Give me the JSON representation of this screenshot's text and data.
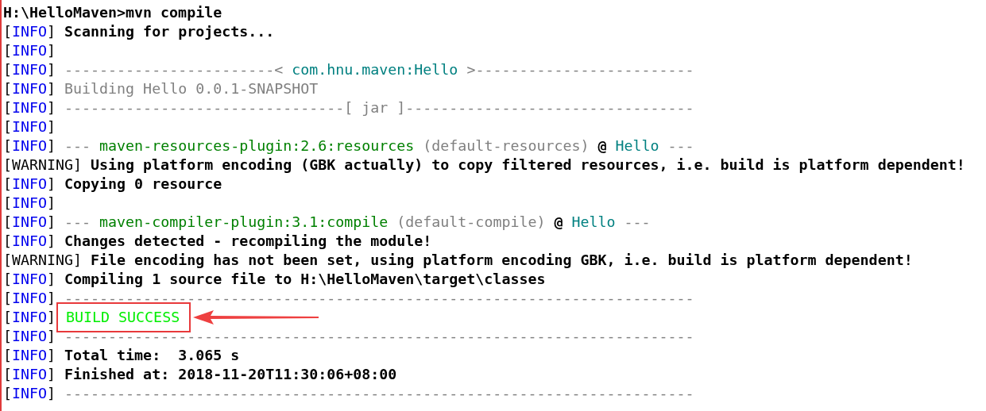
{
  "console": {
    "lines": [
      {
        "segments": [
          {
            "kind": "prompt",
            "text": "H:\\HelloMaven>mvn compile"
          }
        ]
      },
      {
        "segments": [
          {
            "kind": "bracket",
            "text": "["
          },
          {
            "kind": "tag",
            "text": "INFO"
          },
          {
            "kind": "bracket",
            "text": "]"
          },
          {
            "kind": "text",
            "text": " Scanning for projects..."
          }
        ]
      },
      {
        "segments": [
          {
            "kind": "bracket",
            "text": "["
          },
          {
            "kind": "tag",
            "text": "INFO"
          },
          {
            "kind": "bracket",
            "text": "]"
          }
        ]
      },
      {
        "segments": [
          {
            "kind": "bracket",
            "text": "["
          },
          {
            "kind": "tag",
            "text": "INFO"
          },
          {
            "kind": "bracket",
            "text": "]"
          },
          {
            "kind": "dim",
            "text": " ------------------------<"
          },
          {
            "kind": "module",
            "text": " com.hnu.maven:Hello "
          },
          {
            "kind": "dim",
            "text": ">-------------------------"
          }
        ]
      },
      {
        "segments": [
          {
            "kind": "bracket",
            "text": "["
          },
          {
            "kind": "tag",
            "text": "INFO"
          },
          {
            "kind": "bracket",
            "text": "]"
          },
          {
            "kind": "dim",
            "text": " Building Hello 0.0.1-SNAPSHOT"
          }
        ]
      },
      {
        "segments": [
          {
            "kind": "bracket",
            "text": "["
          },
          {
            "kind": "tag",
            "text": "INFO"
          },
          {
            "kind": "bracket",
            "text": "]"
          },
          {
            "kind": "dim",
            "text": " --------------------------------[ jar ]---------------------------------"
          }
        ]
      },
      {
        "segments": [
          {
            "kind": "bracket",
            "text": "["
          },
          {
            "kind": "tag",
            "text": "INFO"
          },
          {
            "kind": "bracket",
            "text": "]"
          }
        ]
      },
      {
        "segments": [
          {
            "kind": "bracket",
            "text": "["
          },
          {
            "kind": "tag",
            "text": "INFO"
          },
          {
            "kind": "bracket",
            "text": "]"
          },
          {
            "kind": "dim",
            "text": " ---"
          },
          {
            "kind": "plugin",
            "text": " maven-resources-plugin:2.6:resources"
          },
          {
            "kind": "dim",
            "text": " (default-resources)"
          },
          {
            "kind": "text",
            "text": " @"
          },
          {
            "kind": "module",
            "text": " Hello"
          },
          {
            "kind": "dim",
            "text": " ---"
          }
        ]
      },
      {
        "segments": [
          {
            "kind": "bracket",
            "text": "[WARNING]"
          },
          {
            "kind": "text",
            "text": " Using platform encoding (GBK actually) to copy filtered resources, i.e. build is platform dependent!"
          }
        ]
      },
      {
        "segments": [
          {
            "kind": "bracket",
            "text": "["
          },
          {
            "kind": "tag",
            "text": "INFO"
          },
          {
            "kind": "bracket",
            "text": "]"
          },
          {
            "kind": "text",
            "text": " Copying 0 resource"
          }
        ]
      },
      {
        "segments": [
          {
            "kind": "bracket",
            "text": "["
          },
          {
            "kind": "tag",
            "text": "INFO"
          },
          {
            "kind": "bracket",
            "text": "]"
          }
        ]
      },
      {
        "segments": [
          {
            "kind": "bracket",
            "text": "["
          },
          {
            "kind": "tag",
            "text": "INFO"
          },
          {
            "kind": "bracket",
            "text": "]"
          },
          {
            "kind": "dim",
            "text": " ---"
          },
          {
            "kind": "plugin",
            "text": " maven-compiler-plugin:3.1:compile"
          },
          {
            "kind": "dim",
            "text": " (default-compile)"
          },
          {
            "kind": "text",
            "text": " @"
          },
          {
            "kind": "module",
            "text": " Hello"
          },
          {
            "kind": "dim",
            "text": " ---"
          }
        ]
      },
      {
        "segments": [
          {
            "kind": "bracket",
            "text": "["
          },
          {
            "kind": "tag",
            "text": "INFO"
          },
          {
            "kind": "bracket",
            "text": "]"
          },
          {
            "kind": "text",
            "text": " Changes detected - recompiling the module!"
          }
        ]
      },
      {
        "segments": [
          {
            "kind": "bracket",
            "text": "[WARNING]"
          },
          {
            "kind": "text",
            "text": " File encoding has not been set, using platform encoding GBK, i.e. build is platform dependent!"
          }
        ]
      },
      {
        "segments": [
          {
            "kind": "bracket",
            "text": "["
          },
          {
            "kind": "tag",
            "text": "INFO"
          },
          {
            "kind": "bracket",
            "text": "]"
          },
          {
            "kind": "text",
            "text": " Compiling 1 source file to H:\\HelloMaven\\target\\classes"
          }
        ]
      },
      {
        "segments": [
          {
            "kind": "bracket",
            "text": "["
          },
          {
            "kind": "tag",
            "text": "INFO"
          },
          {
            "kind": "bracket",
            "text": "]"
          },
          {
            "kind": "dim",
            "text": " ------------------------------------------------------------------------"
          }
        ]
      },
      {
        "segments": [
          {
            "kind": "bracket",
            "text": "["
          },
          {
            "kind": "tag",
            "text": "INFO"
          },
          {
            "kind": "bracket",
            "text": "]"
          },
          {
            "kind": "callout",
            "text": "BUILD SUCCESS"
          }
        ]
      },
      {
        "segments": [
          {
            "kind": "bracket",
            "text": "["
          },
          {
            "kind": "tag",
            "text": "INFO"
          },
          {
            "kind": "bracket",
            "text": "]"
          },
          {
            "kind": "dim",
            "text": " ------------------------------------------------------------------------"
          }
        ]
      },
      {
        "segments": [
          {
            "kind": "bracket",
            "text": "["
          },
          {
            "kind": "tag",
            "text": "INFO"
          },
          {
            "kind": "bracket",
            "text": "]"
          },
          {
            "kind": "text",
            "text": " Total time:  3.065 s"
          }
        ]
      },
      {
        "segments": [
          {
            "kind": "bracket",
            "text": "["
          },
          {
            "kind": "tag",
            "text": "INFO"
          },
          {
            "kind": "bracket",
            "text": "]"
          },
          {
            "kind": "text",
            "text": " Finished at: 2018-11-20T11:30:06+08:00"
          }
        ]
      },
      {
        "segments": [
          {
            "kind": "bracket",
            "text": "["
          },
          {
            "kind": "tag",
            "text": "INFO"
          },
          {
            "kind": "bracket",
            "text": "]"
          },
          {
            "kind": "dim",
            "text": " ------------------------------------------------------------------------"
          }
        ]
      }
    ]
  }
}
